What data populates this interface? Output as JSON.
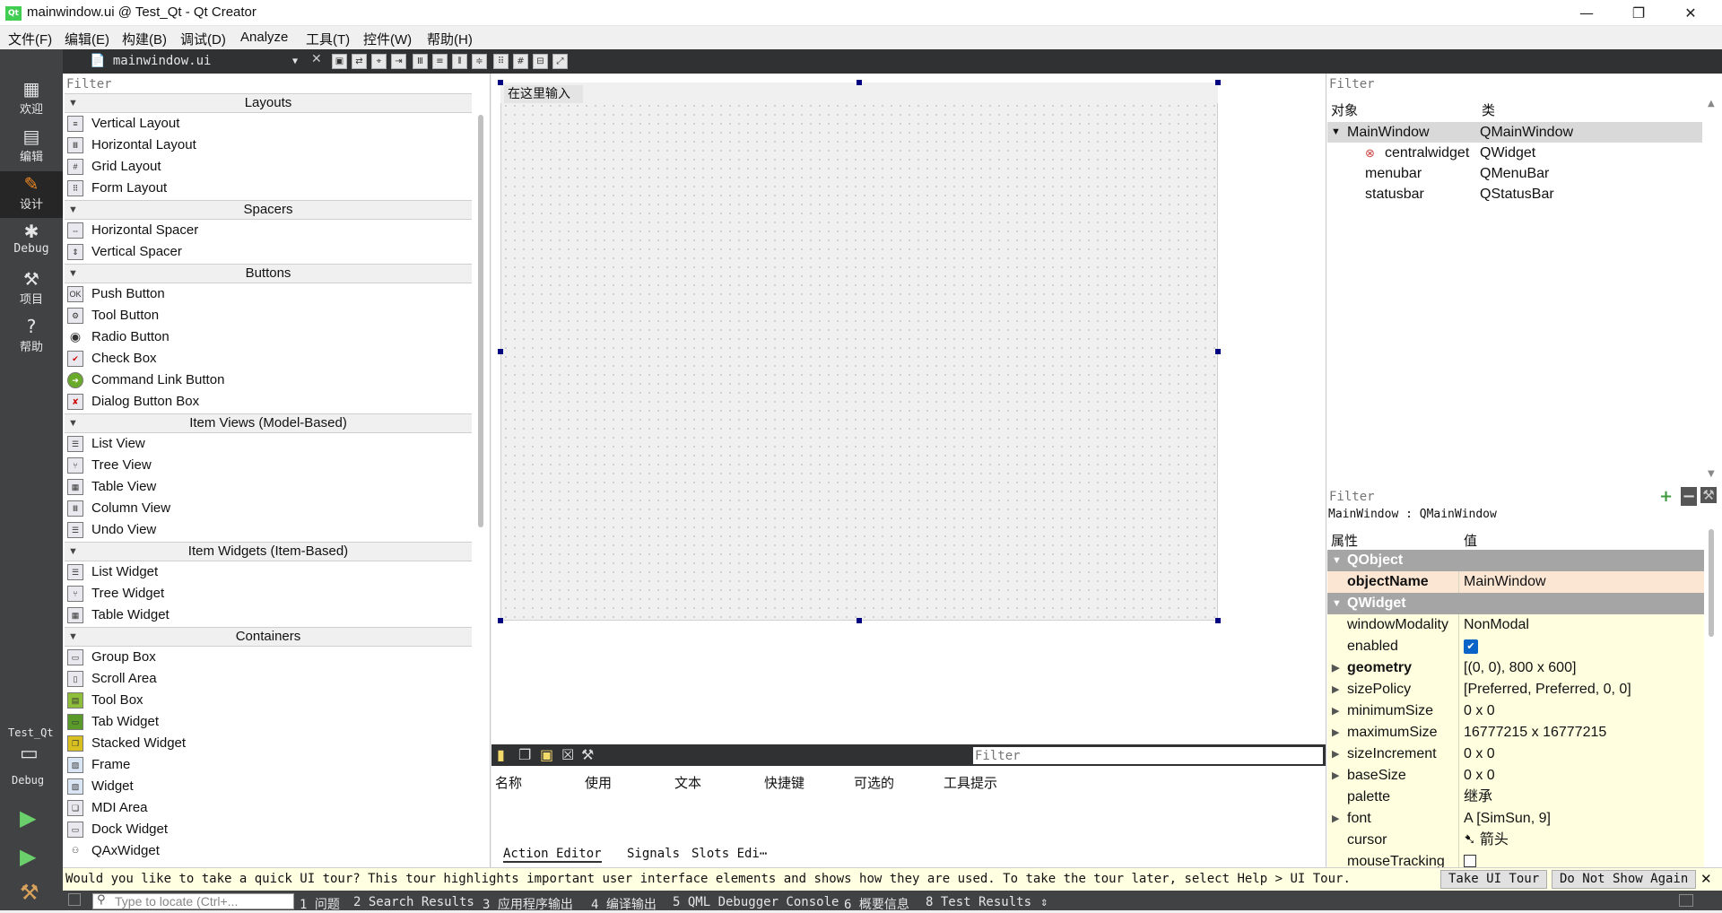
{
  "window": {
    "title": "mainwindow.ui @ Test_Qt - Qt Creator",
    "minimize": "—",
    "maximize": "❐",
    "close": "✕"
  },
  "menubar": [
    "文件(F)",
    "编辑(E)",
    "构建(B)",
    "调试(D)",
    "Analyze",
    "工具(T)",
    "控件(W)",
    "帮助(H)"
  ],
  "modes": [
    {
      "label": "欢迎",
      "icon": "grid-icon"
    },
    {
      "label": "编辑",
      "icon": "edit-doc-icon"
    },
    {
      "label": "设计",
      "icon": "pencil-icon"
    },
    {
      "label": "Debug",
      "icon": "bug-icon"
    },
    {
      "label": "项目",
      "icon": "wrench-icon"
    },
    {
      "label": "帮助",
      "icon": "help-icon"
    }
  ],
  "kit": {
    "project": "Test_Qt",
    "config": "Debug"
  },
  "editor": {
    "file": "mainwindow.ui"
  },
  "widgetbox": {
    "filter_placeholder": "Filter",
    "categories": [
      {
        "name": "Layouts",
        "items": [
          "Vertical Layout",
          "Horizontal Layout",
          "Grid Layout",
          "Form Layout"
        ]
      },
      {
        "name": "Spacers",
        "items": [
          "Horizontal Spacer",
          "Vertical Spacer"
        ]
      },
      {
        "name": "Buttons",
        "items": [
          "Push Button",
          "Tool Button",
          "Radio Button",
          "Check Box",
          "Command Link Button",
          "Dialog Button Box"
        ]
      },
      {
        "name": "Item Views (Model-Based)",
        "items": [
          "List View",
          "Tree View",
          "Table View",
          "Column View",
          "Undo View"
        ]
      },
      {
        "name": "Item Widgets (Item-Based)",
        "items": [
          "List Widget",
          "Tree Widget",
          "Table Widget"
        ]
      },
      {
        "name": "Containers",
        "items": [
          "Group Box",
          "Scroll Area",
          "Tool Box",
          "Tab Widget",
          "Stacked Widget",
          "Frame",
          "Widget",
          "MDI Area",
          "Dock Widget",
          "QAxWidget"
        ]
      }
    ]
  },
  "form": {
    "menu_placeholder": "在这里输入"
  },
  "action_editor": {
    "filter_placeholder": "Filter",
    "columns": [
      "名称",
      "使用",
      "文本",
      "快捷键",
      "可选的",
      "工具提示"
    ],
    "tabs": [
      "Action Editor",
      "Signals",
      "Slots Edi⋯"
    ]
  },
  "object_inspector": {
    "filter_placeholder": "Filter",
    "col_object": "对象",
    "col_class": "类",
    "rows": [
      {
        "object": "MainWindow",
        "class": "QMainWindow"
      },
      {
        "object": "centralwidget",
        "class": "QWidget"
      },
      {
        "object": "menubar",
        "class": "QMenuBar"
      },
      {
        "object": "statusbar",
        "class": "QStatusBar"
      }
    ]
  },
  "property_editor": {
    "filter_placeholder": "Filter",
    "class_line": "MainWindow : QMainWindow",
    "col_property": "属性",
    "col_value": "值",
    "group_qobject": "QObject",
    "group_qwidget": "QWidget",
    "rows": [
      {
        "name": "objectName",
        "value": "MainWindow"
      },
      {
        "name": "windowModality",
        "value": "NonModal"
      },
      {
        "name": "enabled",
        "value": "✔"
      },
      {
        "name": "geometry",
        "value": "[(0, 0), 800 x 600]"
      },
      {
        "name": "sizePolicy",
        "value": "[Preferred, Preferred, 0, 0]"
      },
      {
        "name": "minimumSize",
        "value": "0 x 0"
      },
      {
        "name": "maximumSize",
        "value": "16777215 x 16777215"
      },
      {
        "name": "sizeIncrement",
        "value": "0 x 0"
      },
      {
        "name": "baseSize",
        "value": "0 x 0"
      },
      {
        "name": "palette",
        "value": "继承"
      },
      {
        "name": "font",
        "value": "A  [SimSun, 9]"
      },
      {
        "name": "cursor",
        "value": "➷  箭头"
      },
      {
        "name": "mouseTracking",
        "value": ""
      }
    ]
  },
  "tour": {
    "message": "Would you like to take a quick UI tour? This tour highlights important user interface elements and shows how they are used. To take the tour later, select Help > UI Tour.",
    "take": "Take UI Tour",
    "dismiss": "Do Not Show Again",
    "close": "✕"
  },
  "status": {
    "locator_placeholder": "Type to locate (Ctrl+...",
    "panes": [
      "1 问题",
      "2 Search Results",
      "3 应用程序输出",
      "4 编译输出",
      "5 QML Debugger Console",
      "6 概要信息",
      "8 Test Results"
    ]
  }
}
